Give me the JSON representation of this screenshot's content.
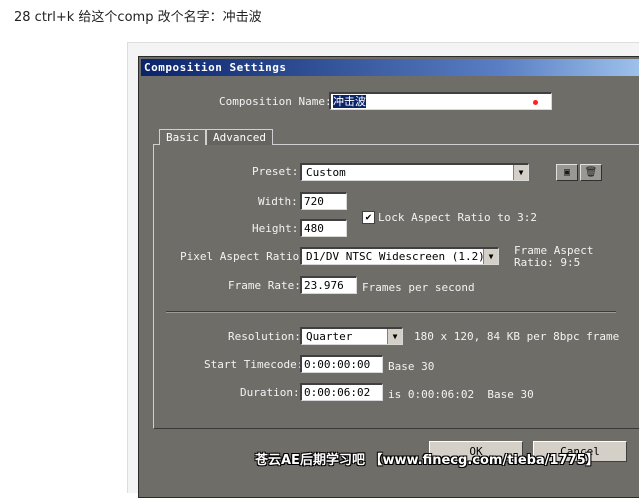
{
  "caption": "28 ctrl+k 给这个comp 改个名字：冲击波",
  "dialog": {
    "title": "Composition Settings",
    "name_label_pre": "",
    "name_label": "Composition Name:",
    "name_value": "冲击波",
    "tabs": [
      "Basic",
      "Advanced"
    ],
    "preset": {
      "label": "Preset:",
      "value": "Custom"
    },
    "width": {
      "label": "Width:",
      "value": "720"
    },
    "height": {
      "label": "Height:",
      "value": "480"
    },
    "lock_aspect": {
      "label": "Lock Aspect Ratio to 3:2",
      "checked": true
    },
    "pixel_aspect": {
      "label": "Pixel Aspect Ratio:",
      "value": "D1/DV NTSC Widescreen (1.2)"
    },
    "frame_aspect": {
      "line1": "Frame Aspect",
      "line2": "Ratio: 9:5"
    },
    "frame_rate": {
      "label": "Frame Rate:",
      "value": "23.976",
      "unit": "Frames per second"
    },
    "resolution": {
      "label": "Resolution:",
      "value": "Quarter",
      "info": "180 x 120, 84 KB per 8bpc frame"
    },
    "start_timecode": {
      "label": "Start Timecode:",
      "value": "0:00:00:00",
      "base": "Base 30"
    },
    "duration": {
      "label": "Duration:",
      "value": "0:00:06:02",
      "info": "is 0:00:06:02  Base 30"
    },
    "ok_label": "OK",
    "cancel_label": "Cancel"
  },
  "watermark": "苍云AE后期学习吧 【www.finecg.com/tieba/1775】",
  "icons": {
    "save": "save-preset-icon",
    "delete": "delete-preset-icon",
    "dropdown": "chevron-down-icon"
  }
}
